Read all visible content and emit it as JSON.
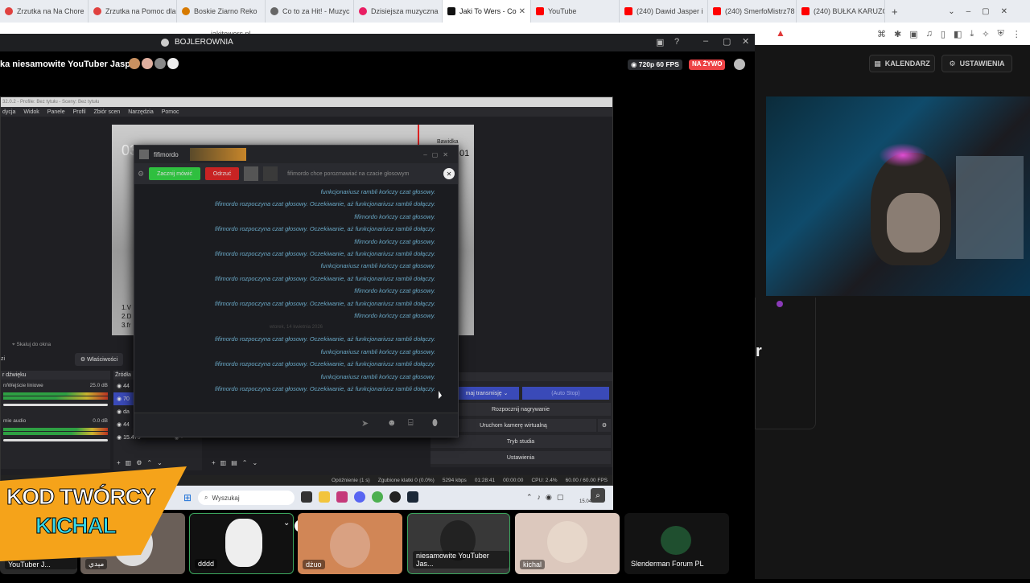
{
  "browser": {
    "tabs": [
      {
        "title": "Zrzutka na Na Chore",
        "color": "#e0413f"
      },
      {
        "title": "Zrzutka na Pomoc dla",
        "color": "#e0413f"
      },
      {
        "title": "Boskie Ziarno Reko",
        "color": "#d77a00"
      },
      {
        "title": "Co to za Hit! - Muzyc",
        "color": "#666"
      },
      {
        "title": "Dzisiejsza muzyczna",
        "color": "#e91e63"
      },
      {
        "title": "Jaki To Wers - Co",
        "color": "#111",
        "active": true
      },
      {
        "title": "YouTube",
        "color": "#ff0000"
      },
      {
        "title": "(240) Dawid Jasper i",
        "color": "#ff0000"
      },
      {
        "title": "(240) SmerfoMistrz78",
        "color": "#ff0000"
      },
      {
        "title": "(240) BUŁKA KARUZO",
        "color": "#ff0000"
      }
    ],
    "url": "jakitowers.pl"
  },
  "discord_window": {
    "title": "BOJLEROWNIA"
  },
  "stream": {
    "streamer_title": "ka niesamowite YouTuber Jasper",
    "quality": "720p 60 FPS",
    "live_label": "NA ŻYWO"
  },
  "right_panel": {
    "calendar": "KALENDARZ",
    "settings": "USTAWIENIA",
    "partial_letter": "r"
  },
  "obs": {
    "title": "32.0.2 - Profile: Bez tytułu - Sceny: Bez tytułu",
    "menu": [
      "dycja",
      "Widok",
      "Panele",
      "Profil",
      "Zbiór scen",
      "Narzędzia",
      "Pomoc"
    ],
    "preview_clock": "03",
    "preview_list": [
      "1.V",
      "2.D",
      "3.fr"
    ],
    "preview_right": "Bawidka",
    "preview_right2": "01",
    "scene_label": "Skaluj do okna",
    "properties": "Właściwości",
    "mixer_title": "r dźwięku",
    "mixer_rows": [
      {
        "name": "n/Wejście liniowe",
        "db": "25.0 dB"
      },
      {
        "name": "mie audio",
        "db": "0.0 dB"
      }
    ],
    "sources_title": "Źródła",
    "sources": [
      "44",
      "70",
      "da",
      "44",
      "15.475"
    ],
    "controls_title": "rujący",
    "controls": {
      "stream": "maj transmisję",
      "auto": "(Auto Stop)",
      "record": "Rozpocznij nagrywanie",
      "vcam": "Uruchom kamerę wirtualną",
      "studio": "Tryb studia",
      "settings": "Ustawienia"
    },
    "status": {
      "delay": "Opóźnienie (1 s)",
      "dropped": "Zgubione klatki 0 (0.0%)",
      "bitrate": "5294 kbps",
      "time": "01:28:41",
      "rec": "00:00:00",
      "cpu": "CPU: 2.4%",
      "fps": "60.00 / 60.00 FPS"
    },
    "zi_label": "zi"
  },
  "chat": {
    "title": "fifimordo",
    "accept": "Zacznij mówić",
    "reject": "Odrzuć",
    "invite": "fifimordo chce porozmawiać na czacie głosowym",
    "lines": [
      "funkcjonariusz rambli kończy czat głosowy.",
      "fifimordo rozpoczyna czat głosowy. Oczekiwanie, aż funkcjonariusz rambli dołączy.",
      "fifimordo kończy czat głosowy.",
      "fifimordo rozpoczyna czat głosowy. Oczekiwanie, aż funkcjonariusz rambli dołączy.",
      "fifimordo kończy czat głosowy.",
      "fifimordo rozpoczyna czat głosowy. Oczekiwanie, aż funkcjonariusz rambli dołączy.",
      "funkcjonariusz rambli kończy czat głosowy.",
      "fifimordo rozpoczyna czat głosowy. Oczekiwanie, aż funkcjonariusz rambli dołączy.",
      "fifimordo kończy czat głosowy.",
      "fifimordo rozpoczyna czat głosowy. Oczekiwanie, aż funkcjonariusz rambli dołączy.",
      "fifimordo kończy czat głosowy."
    ],
    "date_sep": "wtorek, 14 kwietnia 2026",
    "lines2": [
      "fifimordo rozpoczyna czat głosowy. Oczekiwanie, aż funkcjonariusz rambli dołączy.",
      "funkcjonariusz rambli kończy czat głosowy.",
      "fifimordo rozpoczyna czat głosowy. Oczekiwanie, aż funkcjonariusz rambli dołączy.",
      "funkcjonariusz rambli kończy czat głosowy.",
      "fifimordo rozpoczyna czat głosowy. Oczekiwanie, aż funkcjonariusz rambli dołączy."
    ]
  },
  "taskbar": {
    "search": "Wyszukaj",
    "date": "15.04.2026"
  },
  "participants": [
    {
      "name": "niesamowite YouTuber J..."
    },
    {
      "name": "مېدي"
    },
    {
      "name": "dddd"
    },
    {
      "name": "dżuo"
    },
    {
      "name": "niesamowite YouTuber Jas..."
    },
    {
      "name": "kichal"
    },
    {
      "name": "Slenderman Forum PL"
    }
  ],
  "promo": {
    "line1": "KOD TWÓRCY",
    "line2": "KICHAL",
    "accent": "#f5a31a"
  }
}
